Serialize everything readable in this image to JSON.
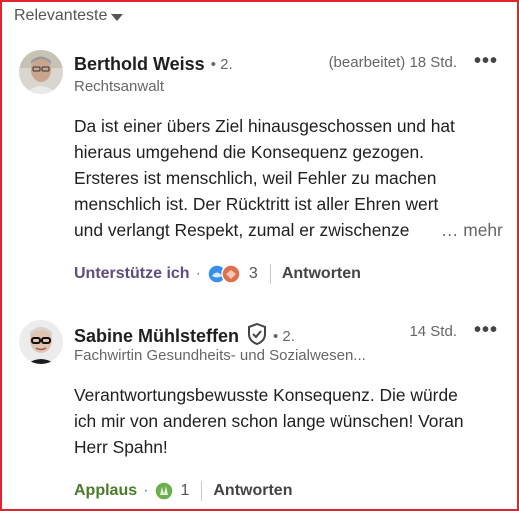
{
  "sort": {
    "label": "Relevanteste"
  },
  "comments": [
    {
      "author": "Berthold Weiss",
      "degree": "• 2.",
      "headline": "Rechtsanwalt",
      "edited": "(bearbeitet)",
      "time": "18 Std.",
      "menu": "•••",
      "text_lines": [
        "Da ist einer übers Ziel hinausgeschossen und hat",
        "hieraus umgehend die Konsequenz gezogen.",
        "Ersteres ist menschlich, weil Fehler zu machen",
        "menschlich ist. Der Rücktritt ist aller Ehren wert",
        "und verlangt Respekt, zumal er zwischenze"
      ],
      "more": "… mehr",
      "reaction_label": "Unterstütze ich",
      "reaction_dot": "·",
      "reaction_count": "3",
      "reply_label": "Antworten",
      "reaction_color": "#5e4d7d"
    },
    {
      "author": "Sabine Mühlsteffen",
      "degree": "• 2.",
      "headline": "Fachwirtin Gesundheits- und Sozialwesen...",
      "time": "14 Std.",
      "menu": "•••",
      "text_lines": [
        "Verantwortungsbewusste Konsequenz. Die würde",
        "ich mir von anderen schon lange wünschen! Voran",
        "Herr Spahn!"
      ],
      "reaction_label": "Applaus",
      "reaction_dot": "·",
      "reaction_count": "1",
      "reply_label": "Antworten",
      "reaction_color": "#4a7a2a"
    }
  ]
}
